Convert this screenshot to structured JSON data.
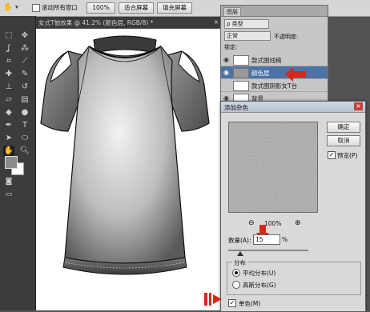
{
  "options_bar": {
    "scroll_all_windows_label": "滚动所有窗口",
    "zoom_100_label": "100%",
    "fit_screen_label": "适合屏幕",
    "fill_screen_label": "填充屏幕"
  },
  "document": {
    "tab_title": "女式T恤效果 @ 41.2% (颜色层, RGB/8) *",
    "tab_close": "×"
  },
  "layers_panel": {
    "tab_label": "图层",
    "filter_label": "ρ 类型",
    "blend_mode": "正常",
    "opacity_label": "不透明度:",
    "lock_label": "锁定:",
    "layers": [
      {
        "name": "款式图线稿",
        "visible": true,
        "selected": false
      },
      {
        "name": "颜色层",
        "visible": true,
        "selected": true
      },
      {
        "name": "款式图阴影女T台",
        "visible": false,
        "selected": false
      },
      {
        "name": "背景",
        "visible": true,
        "selected": false
      }
    ]
  },
  "dialog": {
    "title": "添加杂色",
    "close": "×",
    "ok_label": "确定",
    "cancel_label": "取消",
    "preview_label": "预览(P)",
    "preview_checked": true,
    "zoom_level": "100%",
    "amount_label": "数量(A):",
    "amount_value": "15",
    "amount_unit": "%",
    "amount_slider_fraction": 0.15,
    "distribution_label": "分布",
    "distribution_options": [
      "平均分布(U)",
      "高斯分布(G)"
    ],
    "distribution_selected": 0,
    "monochrome_label": "单色(M)",
    "monochrome_checked": true
  },
  "colors": {
    "accent_red": "#d9261c",
    "selection_blue": "#4d72a6",
    "workspace": "#535353",
    "toolbox": "#3c3c3c"
  },
  "icons": [
    "hand-icon",
    "marquee-icon",
    "lasso-icon",
    "crop-icon",
    "eyedropper-icon",
    "brush-icon",
    "stamp-icon",
    "eraser-icon",
    "gradient-icon",
    "pen-icon",
    "text-icon",
    "path-select-icon",
    "shape-icon",
    "zoom-icon",
    "eye-icon",
    "zoom-in-icon",
    "zoom-out-icon",
    "red-arrow-icon"
  ]
}
